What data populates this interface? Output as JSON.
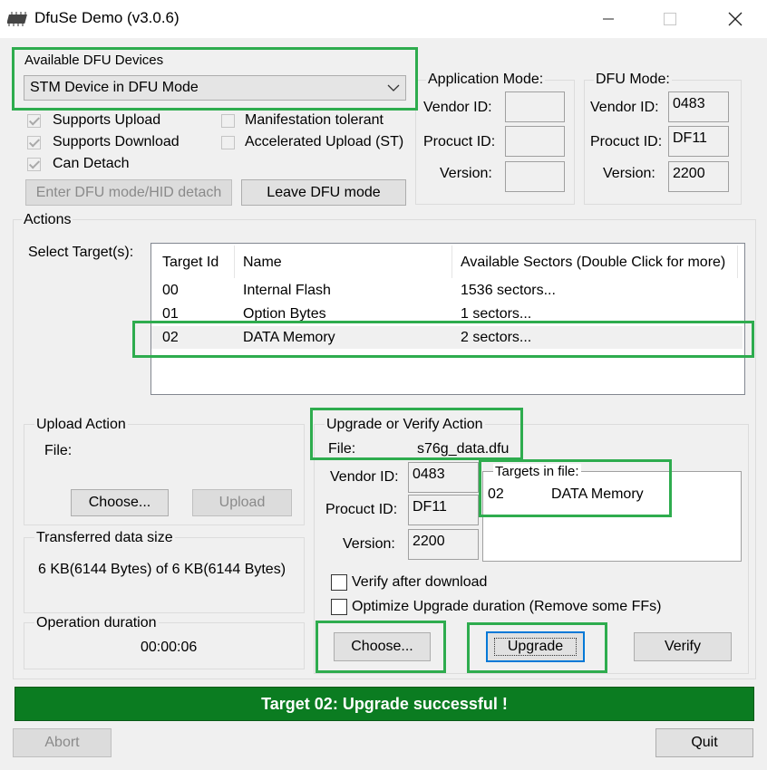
{
  "window": {
    "title": "DfuSe Demo (v3.0.6)"
  },
  "devices": {
    "group_label": "Available DFU Devices",
    "selected_device": "STM Device in DFU Mode",
    "checks": [
      {
        "label": "Supports Upload",
        "checked": true
      },
      {
        "label": "Supports Download",
        "checked": true
      },
      {
        "label": "Can Detach",
        "checked": true
      },
      {
        "label": "Manifestation tolerant",
        "checked": false
      },
      {
        "label": "Accelerated Upload (ST)",
        "checked": false
      }
    ],
    "enter_dfu_label": "Enter DFU mode/HID detach",
    "leave_dfu_label": "Leave DFU mode"
  },
  "app_mode": {
    "label": "Application Mode:",
    "vendor_label": "Vendor ID:",
    "product_label": "Procuct ID:",
    "version_label": "Version:",
    "vendor_value": "",
    "product_value": "",
    "version_value": ""
  },
  "dfu_mode": {
    "label": "DFU Mode:",
    "vendor_label": "Vendor ID:",
    "product_label": "Procuct ID:",
    "version_label": "Version:",
    "vendor_value": "0483",
    "product_value": "DF11",
    "version_value": "2200"
  },
  "actions": {
    "label": "Actions",
    "select_target_label": "Select Target(s):",
    "columns": [
      "Target Id",
      "Name",
      "Available Sectors (Double Click for more)"
    ],
    "rows": [
      [
        "00",
        "Internal Flash",
        "1536 sectors..."
      ],
      [
        "01",
        "Option Bytes",
        "1 sectors..."
      ],
      [
        "02",
        "DATA Memory",
        "2 sectors..."
      ]
    ]
  },
  "upload": {
    "label": "Upload Action",
    "file_label": "File:",
    "choose_label": "Choose...",
    "upload_label": "Upload"
  },
  "transferred": {
    "label": "Transferred data size",
    "value": "6 KB(6144 Bytes) of 6 KB(6144 Bytes)"
  },
  "operation": {
    "label": "Operation duration",
    "value": "00:00:06"
  },
  "upgrade": {
    "label": "Upgrade or Verify Action",
    "file_label": "File:",
    "file_value": "s76g_data.dfu",
    "vendor_label": "Vendor ID:",
    "product_label": "Procuct ID:",
    "version_label": "Version:",
    "vendor_value": "0483",
    "product_value": "DF11",
    "version_value": "2200",
    "targets_label": "Targets in file:",
    "target_id": "02",
    "target_name": "DATA Memory",
    "verify_after_label": "Verify after download",
    "optimize_label": "Optimize Upgrade duration (Remove some FFs)",
    "choose_label": "Choose...",
    "upgrade_label": "Upgrade",
    "verify_label": "Verify"
  },
  "status": {
    "message": "Target 02: Upgrade successful !"
  },
  "footer": {
    "abort_label": "Abort",
    "quit_label": "Quit"
  },
  "colors": {
    "highlight": "#2eac4e",
    "status_bg": "#0b7c21",
    "default_button_border": "#0078d7"
  }
}
